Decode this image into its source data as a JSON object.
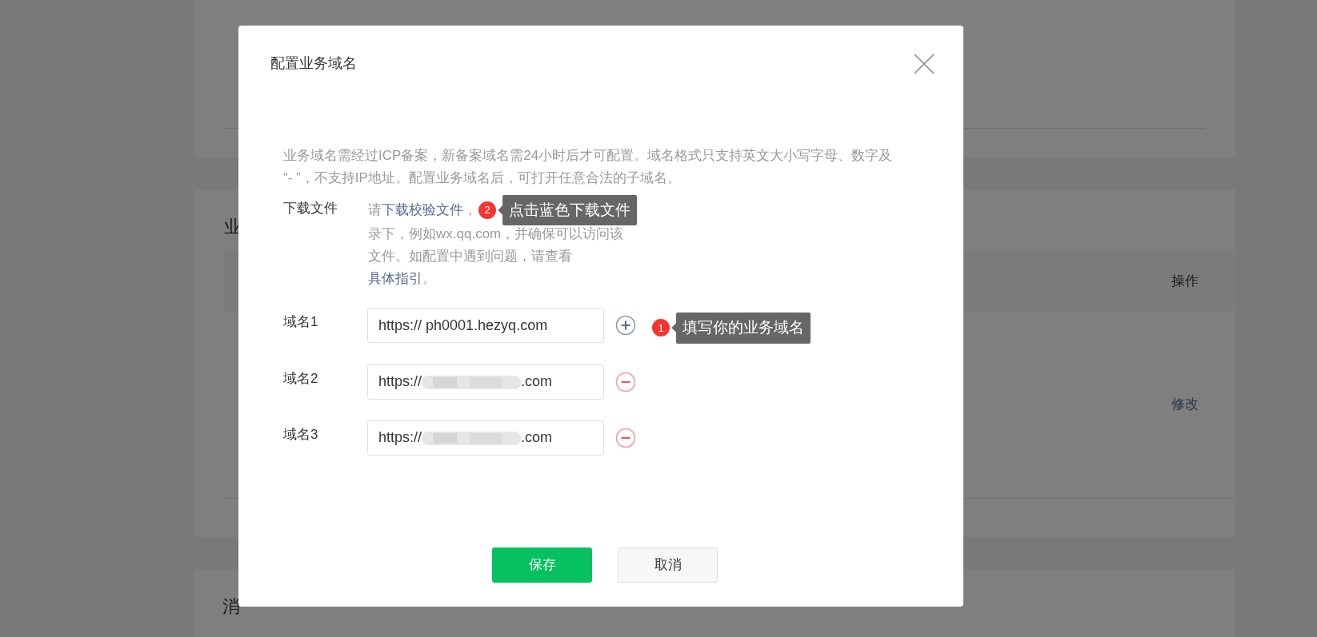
{
  "background": {
    "section_heading": "业",
    "action_column": "操作",
    "row_action": "修改",
    "next_section_heading": "消"
  },
  "dialog": {
    "title": "配置业务域名",
    "intro_lines": [
      "业务域名需经过ICP备案，新备案域名需24小时后才可配置。域名格式只支持英文大小写字母、数字及",
      "“- ”，不支持IP地址。配置业务域名后，可打开任意合法的子域名。"
    ],
    "download": {
      "label": "下载文件",
      "prefix": "请",
      "link": "下载校验文件",
      "after_link": "，",
      "rest": "录下，例如wx.qq.com，并确保可以访问该文件。如配置中遇到问题，请查看",
      "guide_link": "具体指引",
      "end": "。",
      "tip": {
        "badge": "2",
        "text": "点击蓝色下载文件"
      }
    },
    "domains": [
      {
        "label": "域名1",
        "kind": "add",
        "value": "https:// ph0001.hezyq.com",
        "tip": {
          "badge": "1",
          "text": "填写你的业务域名"
        }
      },
      {
        "label": "域名2",
        "kind": "remove",
        "masked": {
          "before": "https://",
          "after": ".com"
        }
      },
      {
        "label": "域名3",
        "kind": "remove",
        "masked": {
          "before": "https://",
          "after": ".com"
        }
      }
    ],
    "buttons": [
      {
        "label": "保存",
        "kind": "primary"
      },
      {
        "label": "取消",
        "kind": "default"
      }
    ]
  }
}
